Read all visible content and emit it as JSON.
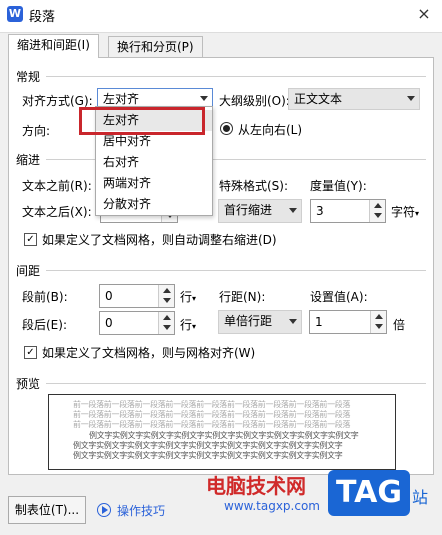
{
  "window": {
    "title": "段落",
    "app_icon": "W",
    "close": "×"
  },
  "tabs": [
    "缩进和间距(I)",
    "换行和分页(P)"
  ],
  "general": {
    "heading": "常规",
    "align_label": "对齐方式(G):",
    "align_value": "左对齐",
    "outline_label": "大纲级别(O):",
    "outline_value": "正文文本",
    "direction_label": "方向:",
    "direction_option": "从左向右(L)"
  },
  "align_menu": {
    "items": [
      "左对齐",
      "居中对齐",
      "右对齐",
      "两端对齐",
      "分散对齐"
    ],
    "selected": 0
  },
  "indent": {
    "heading": "缩进",
    "before_label": "文本之前(R):",
    "after_label": "文本之后(X):",
    "special_label": "特殊格式(S):",
    "special_value": "首行缩进",
    "measure_label": "度量值(Y):",
    "measure_value": "3",
    "measure_unit": "字符",
    "grid_check": "如果定义了文档网格，则自动调整右缩进(D)"
  },
  "spacing": {
    "heading": "间距",
    "before_label": "段前(B):",
    "before_value": "0",
    "before_unit": "行",
    "after_label": "段后(E):",
    "after_value": "0",
    "after_unit": "行",
    "line_label": "行距(N):",
    "line_value": "单倍行距",
    "set_label": "设置值(A):",
    "set_value": "1",
    "set_unit": "倍",
    "grid_check": "如果定义了文档网格，则与网格对齐(W)"
  },
  "preview": {
    "heading": "预览",
    "prev_text": "前一段落前一段落前一段落前一段落前一段落前一段落前一段落前一段落前一段落",
    "sample_text": "例文字实例文字实例文字实例文字实例文字实例文字实例文字实例文字实例文字"
  },
  "footer": {
    "tabs_button": "制表位(T)...",
    "tips": "操作技巧"
  },
  "watermark": {
    "brand": "电脑技术网",
    "url": "www.tagxp.com",
    "logo": "TAG",
    "suffix": "站"
  },
  "colors": {
    "highlight": "#c9262c",
    "accent": "#2b62d9",
    "watermark_red": "#d02a2a"
  }
}
